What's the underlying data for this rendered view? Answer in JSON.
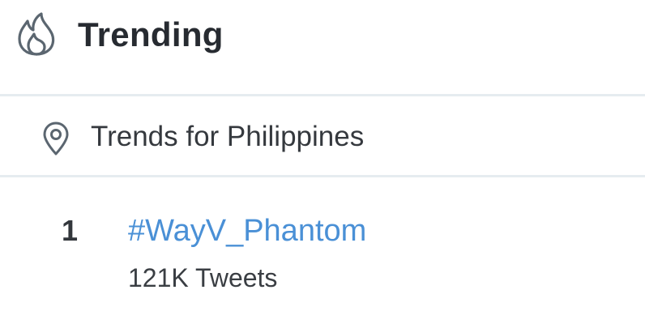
{
  "header": {
    "title": "Trending",
    "icon": "flame-icon"
  },
  "location": {
    "icon": "location-pin-icon",
    "label": "Trends for Philippines"
  },
  "trends": [
    {
      "rank": "1",
      "name": "#WayV_Phantom",
      "count": "121K Tweets"
    }
  ],
  "colors": {
    "link": "#4a90d6",
    "title": "#272b31",
    "divider": "#e6ecf0",
    "icon": "#5b6670"
  }
}
